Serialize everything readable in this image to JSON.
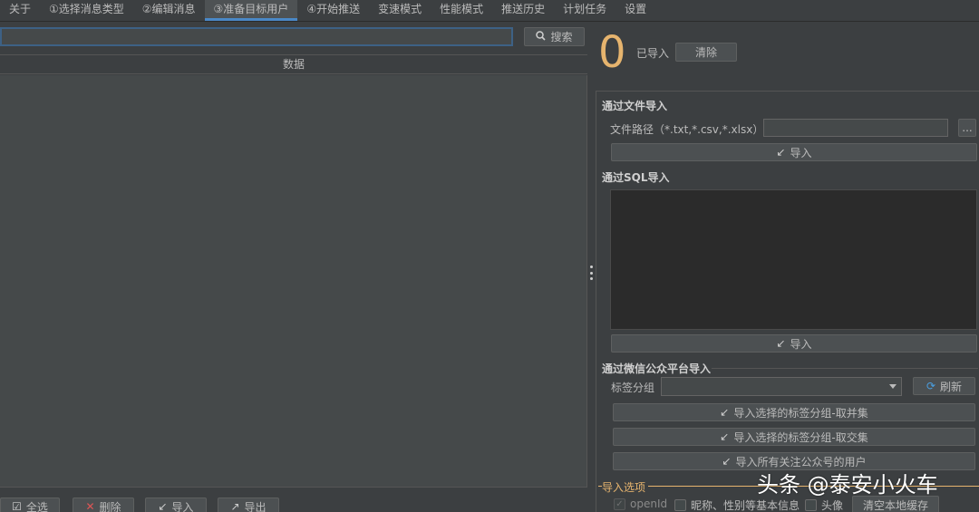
{
  "tabs": [
    {
      "label": "关于"
    },
    {
      "label": "①选择消息类型"
    },
    {
      "label": "②编辑消息"
    },
    {
      "label": "③准备目标用户",
      "active": true
    },
    {
      "label": "④开始推送"
    },
    {
      "label": "变速模式"
    },
    {
      "label": "性能模式"
    },
    {
      "label": "推送历史"
    },
    {
      "label": "计划任务"
    },
    {
      "label": "设置"
    }
  ],
  "left": {
    "search_value": "",
    "search_button": "搜索",
    "search_icon": "search-icon",
    "table_header": "数据",
    "buttons": {
      "select_all": "全选",
      "delete": "删除",
      "import": "导入",
      "export": "导出"
    }
  },
  "right": {
    "count": "0",
    "imported_label": "已导入",
    "clear_button": "清除",
    "file_section": {
      "title": "通过文件导入",
      "path_label": "文件路径（*.txt,*.csv,*.xlsx）",
      "path_value": "",
      "browse_button": "...",
      "import_button": "导入"
    },
    "sql_section": {
      "title": "通过SQL导入",
      "sql_value": "",
      "import_button": "导入"
    },
    "wechat_section": {
      "title": "通过微信公众平台导入",
      "tag_group_label": "标签分组",
      "tag_group_value": "",
      "refresh_button": "刷新",
      "import_union_button": "导入选择的标签分组-取并集",
      "import_intersection_button": "导入选择的标签分组-取交集",
      "import_all_button": "导入所有关注公众号的用户"
    },
    "options_section": {
      "title": "导入选项",
      "openid_label": "openId",
      "basic_info_label": "昵称、性别等基本信息",
      "avatar_label": "头像",
      "clear_cache_button": "清空本地缓存"
    }
  },
  "watermark": "头条 @泰安小火车",
  "colors": {
    "background": "#3c3f41",
    "accent": "#4a88c7",
    "count_orange": "#e6b46e",
    "delete_red": "#e05555"
  }
}
